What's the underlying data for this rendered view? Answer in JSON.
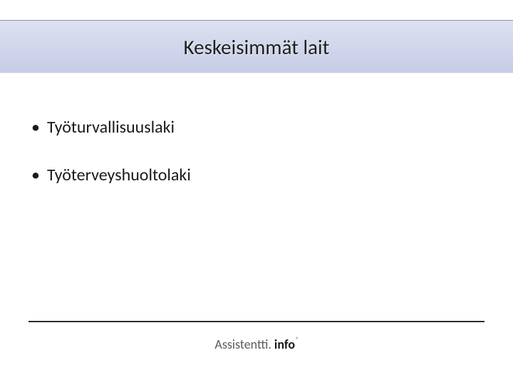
{
  "slide": {
    "title": "Keskeisimmät lait",
    "bullets": [
      "Työturvallisuuslaki",
      "Työterveyshuoltolaki"
    ],
    "footer": {
      "brand_prefix": "Assistentti.",
      "brand_suffix": "info",
      "mark": "®"
    }
  }
}
